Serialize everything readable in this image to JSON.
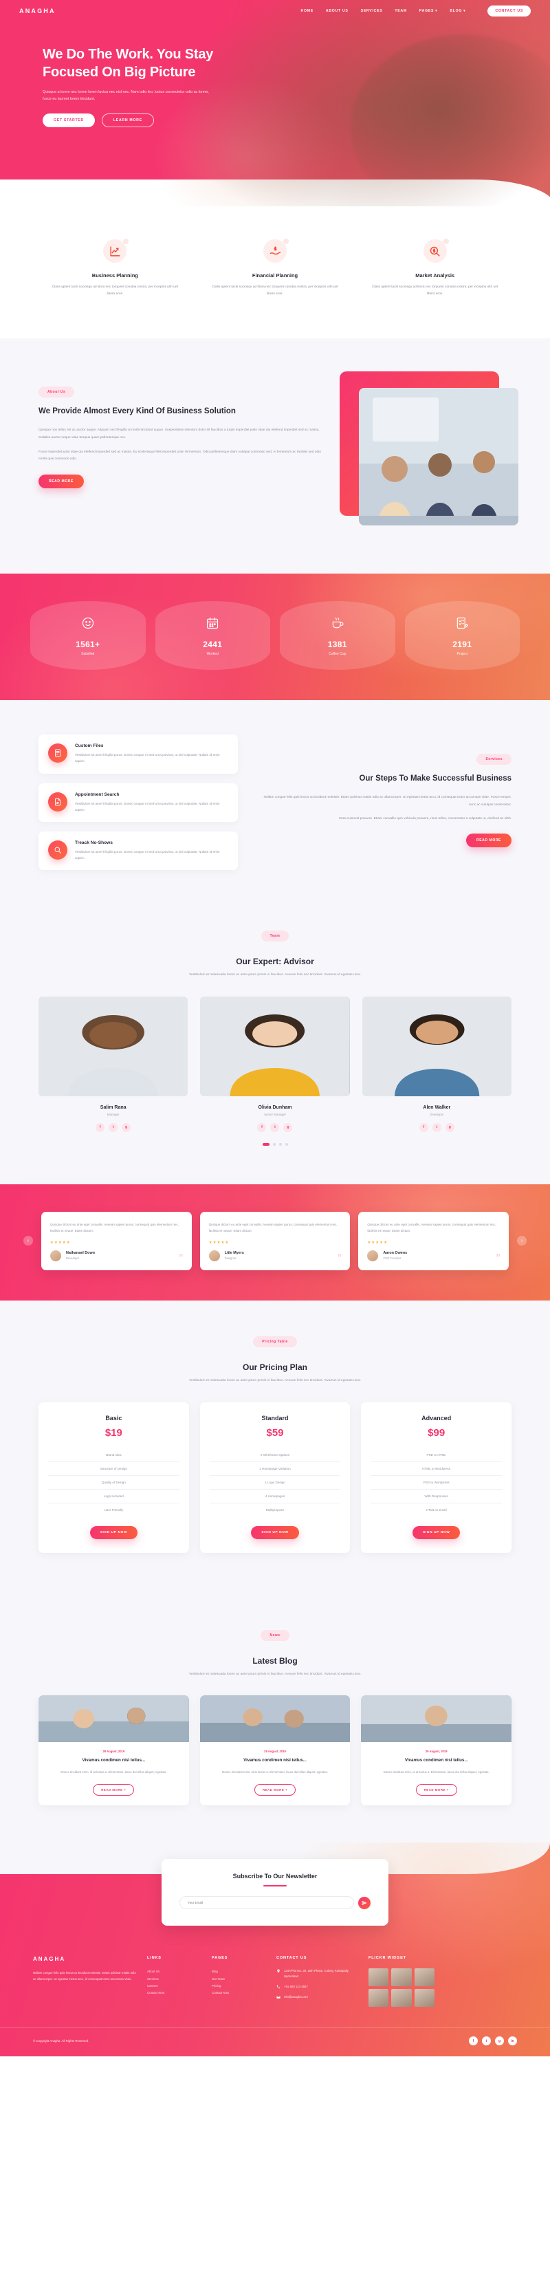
{
  "brand": "ANAGHA",
  "nav": {
    "items": [
      {
        "label": "HOME"
      },
      {
        "label": "ABOUT US"
      },
      {
        "label": "SERVICES"
      },
      {
        "label": "TEAM"
      },
      {
        "label": "PAGES"
      },
      {
        "label": "BLOG"
      }
    ],
    "caret": "▾",
    "cta": "CONTACT US"
  },
  "hero": {
    "title": "We Do The Work. You Stay Focused On Big Picture",
    "subtitle": "Quisque a lorem nec lorem lorem luctus nec nisl nec. Nam odio leo, luctus consectetur odio ac lorem, fusce eu laoreet lorem tincidunt.",
    "btn_primary": "GET STARTED",
    "btn_secondary": "LEARN MORE"
  },
  "services": [
    {
      "icon": "chart-up-icon",
      "title": "Business Planning",
      "text": "Class aptent taciti sociosqu ad litora nec torquent conubia nostra, per inceptos ultri uet libero eros."
    },
    {
      "icon": "hand-money-icon",
      "title": "Financial Planning",
      "text": "Class aptent taciti sociosqu ad litora nec torquent conubia nostra, per inceptos ultri uet libero eros."
    },
    {
      "icon": "search-dollar-icon",
      "title": "Market Analysis",
      "text": "Class aptent taciti sociosqu ad litora nec torquent conubia nostra, per inceptos ultri uet libero eros."
    }
  ],
  "about": {
    "pill": "About Us",
    "title": "We Provide Almost Every Kind Of Business Solution",
    "p1": "Quisque non tellus est ac auctor augue. Aliquam sed fringilla ut morbi tincidunt augue. Suspendisse interdum dolor sit faucibus a turpis imperdiet justo vitae dui eleifend imperdiet sed ac massa. Sodales auctor neque vitae tempus quam pellentesque nec.",
    "p2": "Fusce imperdiet justo vitae dui eleifend imperdiet sed ac massa. Eu scelerisque felis imperdiet proin fermentum. Odio pellentesque diam volutpat commodo sed. At lementum ac facilisis sed odio morbi quis commodo odio.",
    "button": "READ MORE"
  },
  "counters": [
    {
      "icon": "smiley-icon",
      "number": "1561+",
      "label": "Satisfied"
    },
    {
      "icon": "calendar-icon",
      "number": "2441",
      "label": "Worked"
    },
    {
      "icon": "coffee-icon",
      "number": "1381",
      "label": "Coffee Cup"
    },
    {
      "icon": "checklist-icon",
      "number": "2191",
      "label": "Project"
    }
  ],
  "steps": {
    "pill": "Services",
    "title": "Our Steps To Make Successful Business",
    "p1": "Nullam congue felis quis lectus ut tincidunt molestie. Etiam pulvinar mattis odio ac ullamcorper. Ut egestas metus arcu, id consequat tortor accumsan vitae. Fusce tempor, nunc ac volutpat consectetur.",
    "p2": "Cras euismod posuere. Etiam convallis quis vehicula posuere, risus tellus, consectetur a vulputate ut, eleifend ac nibh.",
    "button": "READ MORE",
    "cards": [
      {
        "icon": "file-grid-icon",
        "title": "Custom Files",
        "text": "Vestibulum sit amet fringilla purus. Donec congue mi sed urna pulvinar, ut nisl vulputate. Nullam id enim sapien."
      },
      {
        "icon": "document-icon",
        "title": "Appointment Search",
        "text": "Vestibulum sit amet fringilla purus. Donec congue mi sed urna pulvinar, ut nisl vulputate. Nullam id enim sapien."
      },
      {
        "icon": "magnifier-icon",
        "title": "Treack No-Shows",
        "text": "Vestibulum sit amet fringilla purus. Donec congue mi sed urna pulvinar, ut nisl vulputate. Nullam id enim sapien."
      }
    ]
  },
  "team": {
    "pill": "Team",
    "title": "Our Expert: Advisor",
    "sub": "Vestibulum et malesuada lorem ac ante ipsum primis in faucibus. Aenean felis nec tincidunt. Vivamus id egestas urna.",
    "members": [
      {
        "name": "Salim Rana",
        "role": "Manager"
      },
      {
        "name": "Olivia Dunham",
        "role": "Senior Manager"
      },
      {
        "name": "Alen Walker",
        "role": "Developer"
      }
    ],
    "social_icons": [
      "f",
      "t",
      "g"
    ]
  },
  "testimonials": [
    {
      "text": "Quisque dictum eu ante eget convallis. Aenean sapien purus, consequat quis elementum nec, facilisis et neque. Etiam dictum.",
      "stars": "★★★★★",
      "name": "Nathanael Down",
      "role": "Developer"
    },
    {
      "text": "Quisque dictum eu ante eget convallis. Aenean sapien purus, consequat quis elementum nec, facilisis et neque. Etiam dictum.",
      "stars": "★★★★★",
      "name": "Litle Myers",
      "role": "Designer"
    },
    {
      "text": "Quisque dictum eu ante eget convallis. Aenean sapien purus, consequat quis elementum nec, facilisis et neque. Etiam dictum.",
      "stars": "★★★★★",
      "name": "Aaron Owens",
      "role": "CEO Founder"
    }
  ],
  "pricing": {
    "pill": "Pricing Table",
    "title": "Our Pricing Plan",
    "sub": "Vestibulum et malesuada lorem ac ante ipsum primis in faucibus. Aenean felis nec tincidunt. Vivamus id egestas urna.",
    "plans": [
      {
        "name": "Basic",
        "price": "$19",
        "features": [
          "Brand Idea",
          "Structure of Design",
          "Quality of Design",
          "Logo Included",
          "User Friendly"
        ],
        "button": "SIGN UP NOW"
      },
      {
        "name": "Standard",
        "price": "$59",
        "features": [
          "2 Wireframe Options",
          "2 Homepage Variation",
          "1 Logo Design",
          "4 Homepages",
          "Multipurpose"
        ],
        "button": "SIGN UP NOW"
      },
      {
        "name": "Advanced",
        "price": "$99",
        "features": [
          "PSD to HTML",
          "HTML to Wordpress",
          "PSD to Wordpress",
          "With Responsive",
          "HTML in Email"
        ],
        "button": "SIGN UP NOW"
      }
    ]
  },
  "blog": {
    "pill": "News",
    "title": "Latest Blog",
    "sub": "Vestibulum et malesuada lorem ac ante ipsum primis in faucibus. Aenean felis nec tincidunt. Vivamus id egestas urna.",
    "posts": [
      {
        "date": "29 August, 2019",
        "title": "Vivamus condimen nisl tellus...",
        "text": "Donec tincidunt enim, id at luctus a. Elementum, lacus dui tellus aliquet, egestas.",
        "button": "READ MORE +"
      },
      {
        "date": "29 August, 2019",
        "title": "Vivamus condimen nisl tellus...",
        "text": "Donec tincidunt enim, id at luctus a. Elementum, lacus dui tellus aliquet, egestas.",
        "button": "READ MORE +"
      },
      {
        "date": "29 August, 2019",
        "title": "Vivamus condimen nisl tellus...",
        "text": "Donec tincidunt enim, id at luctus a. Elementum, lacus dui tellus aliquet, egestas.",
        "button": "READ MORE +"
      }
    ]
  },
  "newsletter": {
    "title": "Subscribe To Our Newsletter",
    "placeholder": "Your Email",
    "button_icon": "send-icon"
  },
  "footer": {
    "brand": "ANAGHA",
    "about": "Nullam congue felis quis lectus ut tincidunt molestie. Etiam pulvinar mattis odio ac ullamcorper. Ut egestas metus arcu, id consequat tortor accumsan vitae.",
    "links_head": "LINKS",
    "links": [
      "About Us",
      "Services",
      "Careers",
      "Contact Now"
    ],
    "pages_head": "PAGES",
    "pages": [
      "Blog",
      "Our Team",
      "Pricing",
      "Contact Now"
    ],
    "contact_head": "CONTACT US",
    "contacts": [
      {
        "icon": "location-icon",
        "text": "1247/Plot No. 39, 15th Phase, Colony, Kukatpally, Hyderabad"
      },
      {
        "icon": "phone-icon",
        "text": "+91 800 123 4567"
      },
      {
        "icon": "mail-icon",
        "text": "info@anagha.com"
      }
    ],
    "flickr_head": "FLICKR WIDGET",
    "copyright": "© Copyright Anagha. All Rights Reserved.",
    "socials": [
      "f",
      "t",
      "g",
      "in"
    ]
  },
  "colors": {
    "accent": "#f5356e",
    "accent2": "#fb5c3e",
    "dark": "#2b2b3b",
    "muted": "#9292a2",
    "bg": "#f7f7fb"
  }
}
